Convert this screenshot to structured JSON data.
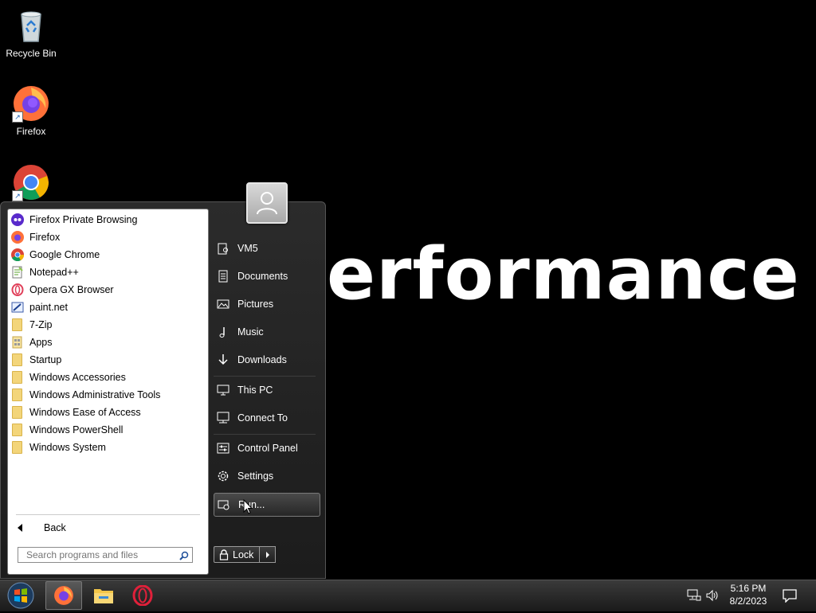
{
  "desktop": {
    "icons": [
      {
        "label": "Recycle Bin",
        "icon": "recycle-bin-icon"
      },
      {
        "label": "Firefox",
        "icon": "firefox-icon"
      },
      {
        "label": "",
        "icon": "chrome-icon"
      }
    ],
    "wallpaper_text": "erformance"
  },
  "start_menu": {
    "programs": [
      {
        "label": "Firefox Private Browsing",
        "icon": "firefox-private-icon"
      },
      {
        "label": "Firefox",
        "icon": "firefox-icon"
      },
      {
        "label": "Google Chrome",
        "icon": "chrome-icon"
      },
      {
        "label": "Notepad++",
        "icon": "notepad-plus-plus-icon"
      },
      {
        "label": "Opera GX Browser",
        "icon": "opera-gx-icon"
      },
      {
        "label": "paint.net",
        "icon": "paint-net-icon"
      },
      {
        "label": "7-Zip",
        "icon": "folder-icon"
      },
      {
        "label": "Apps",
        "icon": "apps-icon"
      },
      {
        "label": "Startup",
        "icon": "folder-icon"
      },
      {
        "label": "Windows Accessories",
        "icon": "folder-icon"
      },
      {
        "label": "Windows Administrative Tools",
        "icon": "folder-icon"
      },
      {
        "label": "Windows Ease of Access",
        "icon": "folder-icon"
      },
      {
        "label": "Windows PowerShell",
        "icon": "folder-icon"
      },
      {
        "label": "Windows System",
        "icon": "folder-icon"
      }
    ],
    "back_label": "Back",
    "search_placeholder": "Search programs and files",
    "right_items": [
      {
        "label": "VM5",
        "icon": "user-folder-icon"
      },
      {
        "label": "Documents",
        "icon": "documents-icon"
      },
      {
        "label": "Pictures",
        "icon": "pictures-icon"
      },
      {
        "label": "Music",
        "icon": "music-icon"
      },
      {
        "label": "Downloads",
        "icon": "downloads-icon"
      },
      {
        "label": "This PC",
        "icon": "this-pc-icon"
      },
      {
        "label": "Connect To",
        "icon": "connect-to-icon"
      },
      {
        "label": "Control Panel",
        "icon": "control-panel-icon"
      },
      {
        "label": "Settings",
        "icon": "settings-gear-icon"
      },
      {
        "label": "Run...",
        "icon": "run-icon"
      }
    ],
    "lock_label": "Lock"
  },
  "taskbar": {
    "apps": [
      "firefox-icon",
      "file-explorer-icon",
      "opera-icon"
    ],
    "clock_time": "5:16 PM",
    "clock_date": "8/2/2023"
  }
}
